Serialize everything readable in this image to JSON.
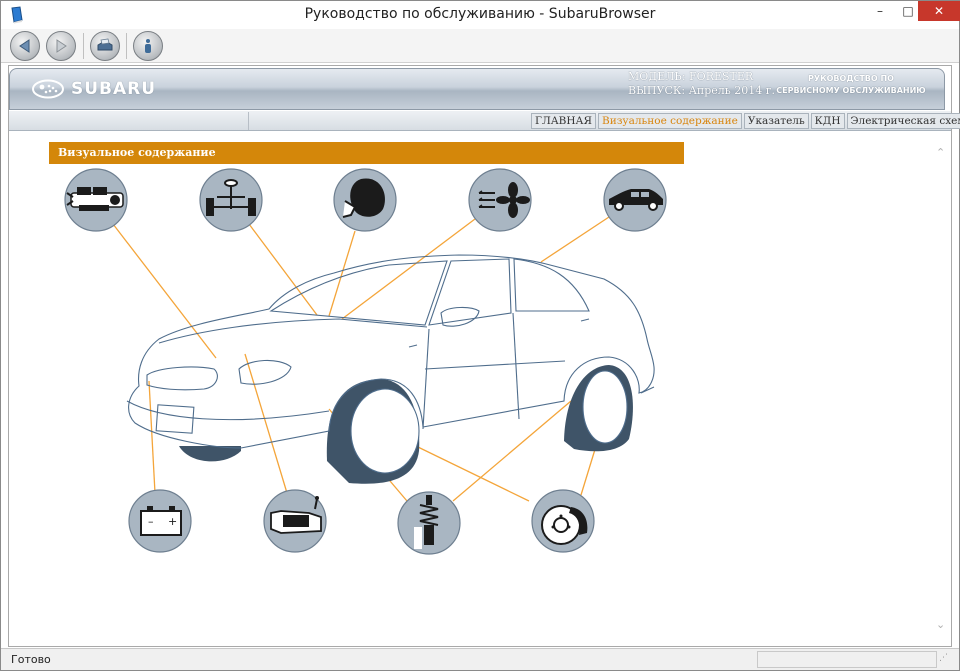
{
  "window": {
    "title": "Руководство по обслуживанию - SubaruBrowser",
    "min_glyph": "–",
    "max_glyph": "□",
    "close_glyph": "✕"
  },
  "toolbar": {
    "buttons": [
      "back-icon",
      "forward-icon",
      "print-icon",
      "info-icon"
    ]
  },
  "banner": {
    "logo_text": "SUBARU",
    "model_line": "МОДЕЛЬ: FORESTER",
    "release_line": "ВЫПУСК: Апрель 2014 г.",
    "manual_line1": "РУКОВОДСТВО ПО",
    "manual_line2": "СЕРВИСНОМУ ОБСЛУЖИВАНИЮ"
  },
  "nav": {
    "tabs": [
      {
        "label": "ГЛАВНАЯ",
        "active": false
      },
      {
        "label": "Визуальное содержание",
        "active": true
      },
      {
        "label": "Указатель",
        "active": false
      },
      {
        "label": "КДН",
        "active": false
      },
      {
        "label": "Электрическая схема",
        "active": false
      }
    ]
  },
  "section": {
    "title": "Визуальное содержание"
  },
  "diagram": {
    "hotspots_top": [
      "engine-icon",
      "steering-suspension-icon",
      "airbag-icon",
      "hvac-icon",
      "body-icon"
    ],
    "hotspots_bottom": [
      "battery-icon",
      "transmission-icon",
      "shock-absorber-icon",
      "brake-disc-icon"
    ],
    "battery_minus": "–",
    "battery_plus": "+",
    "leader_color": "#f4a53a",
    "outline_color": "#4f6d8c",
    "tire_color": "#3f5468",
    "icon_bg": "#a9b6c2"
  },
  "status": {
    "text": "Готово"
  },
  "colors": {
    "accent": "#d4870a",
    "active_tab": "#d9860f"
  }
}
